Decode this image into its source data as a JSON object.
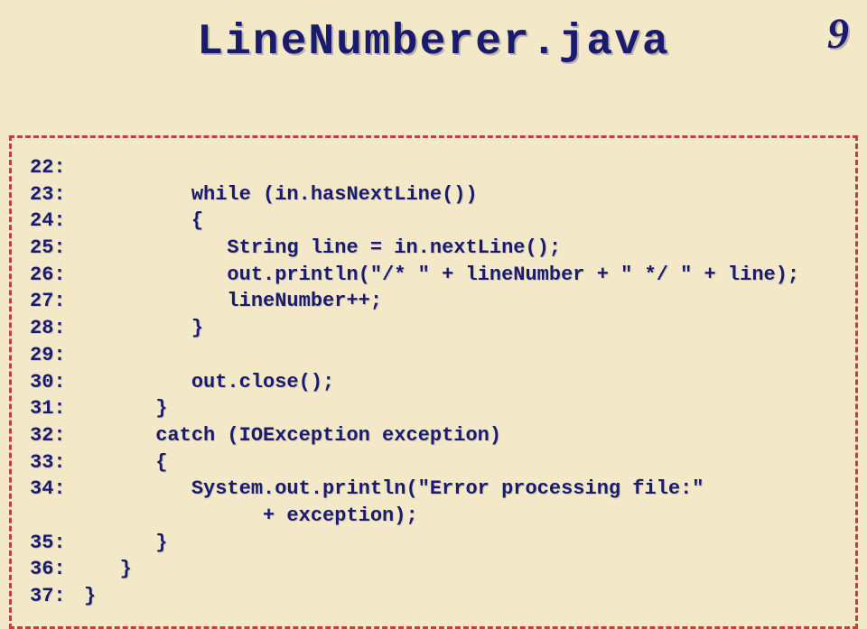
{
  "title": "LineNumberer.java",
  "page_number": "9",
  "code_lines": [
    {
      "num": "22:",
      "indent": "",
      "text": ""
    },
    {
      "num": "23:",
      "indent": "         ",
      "text": "while (in.hasNextLine())"
    },
    {
      "num": "24:",
      "indent": "         ",
      "text": "{"
    },
    {
      "num": "25:",
      "indent": "            ",
      "text": "String line = in.nextLine();"
    },
    {
      "num": "26:",
      "indent": "            ",
      "text": "out.println(\"/* \" + lineNumber + \" */ \" + line);"
    },
    {
      "num": "27:",
      "indent": "            ",
      "text": "lineNumber++;"
    },
    {
      "num": "28:",
      "indent": "         ",
      "text": "}"
    },
    {
      "num": "29:",
      "indent": "",
      "text": ""
    },
    {
      "num": "30:",
      "indent": "         ",
      "text": "out.close();"
    },
    {
      "num": "31:",
      "indent": "      ",
      "text": "}"
    },
    {
      "num": "32:",
      "indent": "      ",
      "text": "catch (IOException exception)"
    },
    {
      "num": "33:",
      "indent": "      ",
      "text": "{"
    },
    {
      "num": "34:",
      "indent": "         ",
      "text": "System.out.println(\"Error processing file:\""
    },
    {
      "num": "",
      "indent": "               ",
      "text": "+ exception);"
    },
    {
      "num": "35:",
      "indent": "      ",
      "text": "}"
    },
    {
      "num": "36:",
      "indent": "   ",
      "text": "}"
    },
    {
      "num": "37:",
      "indent": "",
      "text": "}"
    }
  ]
}
